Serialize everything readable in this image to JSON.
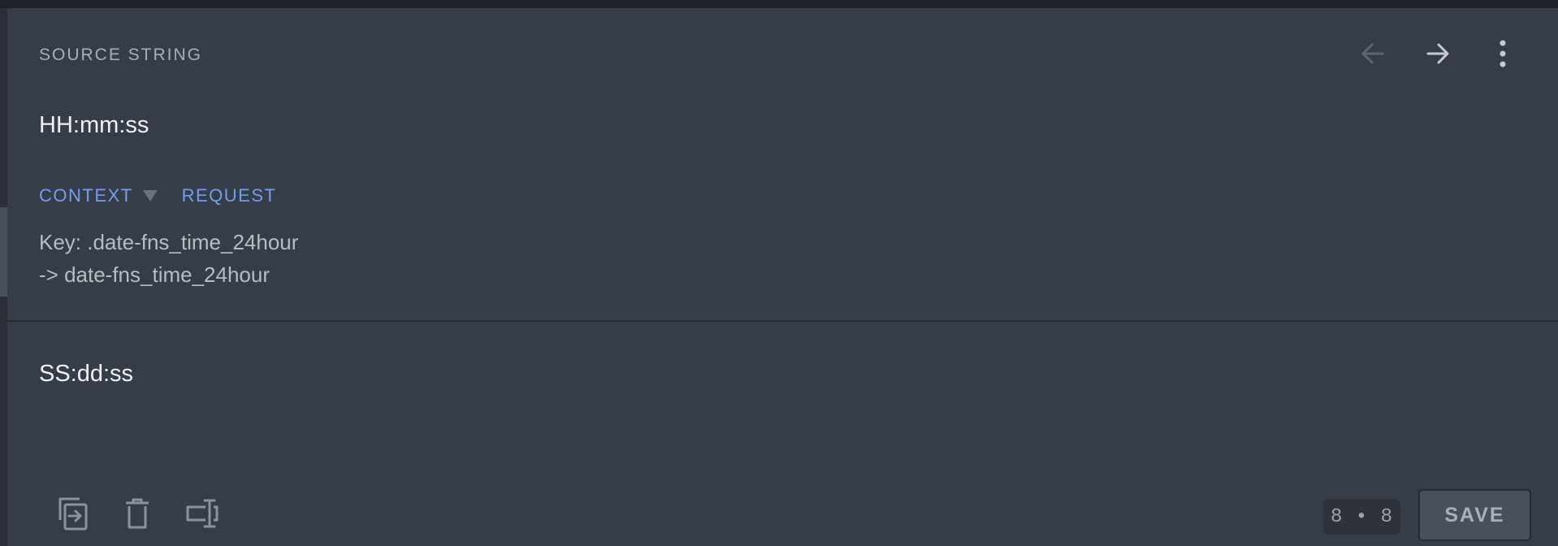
{
  "source": {
    "section_title": "SOURCE STRING",
    "text": "HH:mm:ss",
    "nav": {
      "prev_icon": "arrow-left-icon",
      "next_icon": "arrow-right-icon",
      "more_icon": "more-vertical-icon"
    },
    "tabs": {
      "context_label": "CONTEXT",
      "request_label": "REQUEST"
    },
    "context_lines": [
      "Key: .date-fns_time_24hour",
      "-> date-fns_time_24hour"
    ]
  },
  "translation": {
    "value": "SS:dd:ss",
    "tools": {
      "copy_icon": "copy-source-icon",
      "delete_icon": "trash-icon",
      "insert_icon": "insert-placeholder-icon"
    },
    "counter": "8 • 8",
    "save_label": "SAVE"
  },
  "colors": {
    "background": "#373d48",
    "accent": "#6e9ff0",
    "divider": "#262a31",
    "muted_text": "#a9adb5"
  }
}
